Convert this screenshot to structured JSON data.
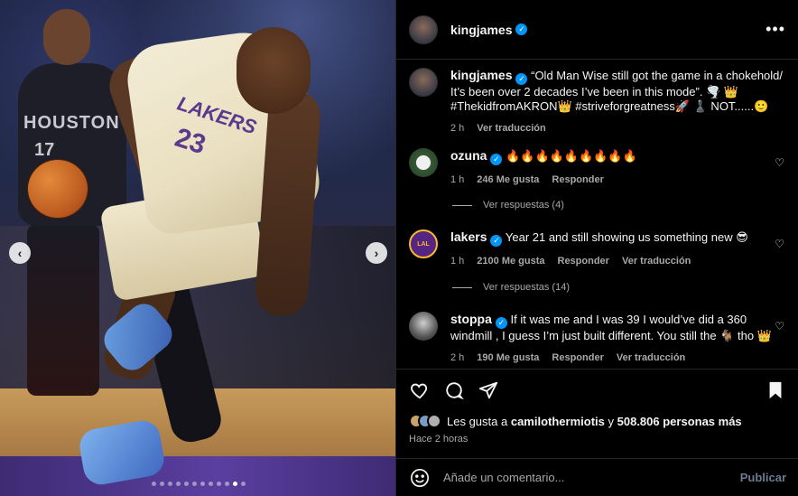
{
  "post": {
    "username": "kingjames",
    "caption": "“Old Man Wise still got the game in a chokehold/ It’s been over 2 decades I’ve been in this mode”. 🌪️ 👑 #ThekidfromAKRON👑 #striveforgreatness🚀 ♟️ NOT......🙂",
    "caption_time": "2 h",
    "caption_translate": "Ver traducción",
    "more_icon": "more-horizontal-icon"
  },
  "photo": {
    "jersey_left": "HOUSTON",
    "jersey_left_num": "17",
    "jersey_right": "LAKERS",
    "jersey_right_num": "23",
    "carousel_dots": 12,
    "active_dot": 10
  },
  "comments": [
    {
      "username": "ozuna",
      "text": "🔥🔥🔥🔥🔥🔥🔥🔥🔥",
      "time": "1 h",
      "likes": "246 Me gusta",
      "reply": "Responder",
      "view_replies": "Ver respuestas (4)"
    },
    {
      "username": "lakers",
      "text": "Year 21 and still showing us something new 😎",
      "time": "1 h",
      "likes": "2100 Me gusta",
      "reply": "Responder",
      "translate": "Ver traducción",
      "view_replies": "Ver respuestas (14)"
    },
    {
      "username": "stoppa",
      "text": "If it was me and I was 39 I would’ve did a 360 windmill , I guess I’m just built different. You still the 🐐 tho 👑",
      "time": "2 h",
      "likes": "190 Me gusta",
      "reply": "Responder",
      "translate": "Ver traducción"
    }
  ],
  "likes_line": {
    "prefix": "Les gusta a",
    "user": "camilothermiotis",
    "middle": "y",
    "count": "508.806 personas más"
  },
  "posted_ago": "Hace 2 horas",
  "add_comment": {
    "placeholder": "Añade un comentario...",
    "publish": "Publicar"
  },
  "colors": {
    "verified": "#0095f6",
    "secondary_text": "#a8a8a8",
    "publish_disabled": "#6b7c93"
  }
}
